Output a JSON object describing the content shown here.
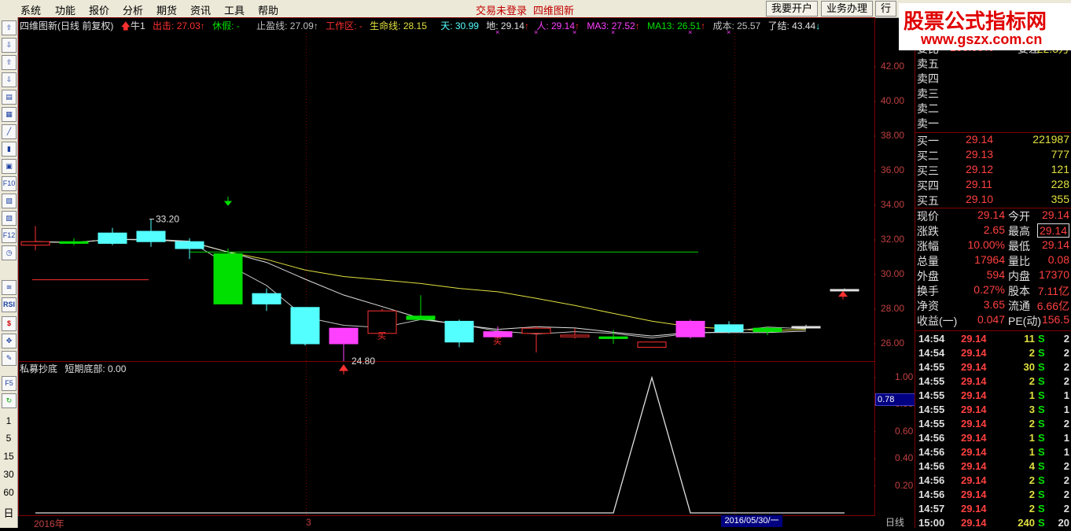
{
  "menu": {
    "items": [
      "系统",
      "功能",
      "报价",
      "分析",
      "期货",
      "资讯",
      "工具",
      "帮助"
    ],
    "status_login": "交易未登录",
    "status_view": "四维图新",
    "buttons": [
      "我要开户",
      "业务办理",
      "行"
    ]
  },
  "toolbar": {
    "icons": [
      "up-arrow-icon",
      "down-arrow-icon",
      "up-arrow-icon",
      "down-arrow-icon",
      "report-icon",
      "table-icon",
      "line-chart-icon",
      "candle-icon",
      "window-icon",
      "f10-icon",
      "news-icon",
      "doc-icon",
      "f12-icon",
      "clock-icon",
      "multi-chart-icon",
      "rsi-icon",
      "dollar-icon",
      "move-icon",
      "pencil-icon",
      "f5-icon",
      "refresh-icon"
    ],
    "icon_labels": {
      "f10": "F10",
      "f12": "F12",
      "rsi": "RSI",
      "f5": "F5",
      "dollar": "$"
    },
    "periods": [
      "1",
      "5",
      "15",
      "30",
      "60",
      "日"
    ]
  },
  "info": {
    "title": "四维图新(日线 前复权)",
    "niu": "牛1",
    "chuji": "出击: 27.03",
    "xiujia": "休假: -",
    "zhiying": "止盈线: 27.09",
    "gongzuoqu": "工作区: -",
    "shengming": "生命线: 28.15",
    "tian": "天: 30.99",
    "di": "地: 29.14",
    "ren": "人: 29.14",
    "ma3": "MA3: 27.52",
    "ma13": "MA13: 26.51",
    "chengben": "成本: 25.57",
    "liaojie": "了结: 43.44"
  },
  "indicator": {
    "name": "私募抄底",
    "value": "短期底部: 0.00",
    "current": "0.78"
  },
  "chart_data": {
    "type": "candlestick",
    "price_ticks": [
      "42.00",
      "40.00",
      "38.00",
      "36.00",
      "34.00",
      "32.00",
      "30.00",
      "28.00",
      "26.00"
    ],
    "price_range": [
      25.0,
      43.5
    ],
    "indicator_ticks": [
      "1.00",
      "0.80",
      "0.60",
      "0.40",
      "0.20"
    ],
    "indicator_range": [
      0,
      1
    ],
    "high_label": "33.20",
    "low_label": "24.80",
    "buy_marks": [
      "买",
      "买"
    ],
    "candles": [
      {
        "o": 31.7,
        "h": 32.8,
        "l": 31.4,
        "c": 31.9,
        "color": "red"
      },
      {
        "o": 31.9,
        "h": 32.1,
        "l": 31.7,
        "c": 31.8,
        "color": "green"
      },
      {
        "o": 31.8,
        "h": 32.7,
        "l": 31.7,
        "c": 32.4,
        "color": "cyan"
      },
      {
        "o": 32.5,
        "h": 33.2,
        "l": 31.6,
        "c": 31.9,
        "color": "cyan"
      },
      {
        "o": 31.9,
        "h": 32.1,
        "l": 30.9,
        "c": 31.5,
        "color": "cyan"
      },
      {
        "o": 31.2,
        "h": 31.5,
        "l": 28.3,
        "c": 28.3,
        "color": "green"
      },
      {
        "o": 28.9,
        "h": 29.2,
        "l": 27.9,
        "c": 28.3,
        "color": "cyan"
      },
      {
        "o": 28.1,
        "h": 28.1,
        "l": 25.9,
        "c": 26.0,
        "color": "cyan"
      },
      {
        "o": 26.0,
        "h": 26.9,
        "l": 25.0,
        "c": 26.9,
        "color": "magenta"
      },
      {
        "o": 26.6,
        "h": 28.0,
        "l": 26.5,
        "c": 27.9,
        "color": "red"
      },
      {
        "o": 27.6,
        "h": 28.8,
        "l": 27.5,
        "c": 27.4,
        "color": "green"
      },
      {
        "o": 27.3,
        "h": 27.4,
        "l": 25.8,
        "c": 26.1,
        "color": "cyan"
      },
      {
        "o": 26.4,
        "h": 27.0,
        "l": 26.3,
        "c": 26.7,
        "color": "magenta"
      },
      {
        "o": 26.6,
        "h": 27.0,
        "l": 25.5,
        "c": 26.9,
        "color": "red"
      },
      {
        "o": 26.4,
        "h": 26.9,
        "l": 26.3,
        "c": 26.5,
        "color": "red"
      },
      {
        "o": 26.3,
        "h": 26.8,
        "l": 26.0,
        "c": 26.4,
        "color": "green"
      },
      {
        "o": 25.8,
        "h": 26.1,
        "l": 25.8,
        "c": 26.1,
        "color": "red"
      },
      {
        "o": 26.4,
        "h": 27.4,
        "l": 26.3,
        "c": 27.3,
        "color": "magenta"
      },
      {
        "o": 27.1,
        "h": 27.3,
        "l": 26.6,
        "c": 26.7,
        "color": "cyan"
      },
      {
        "o": 26.7,
        "h": 27.0,
        "l": 26.5,
        "c": 26.9,
        "color": "green"
      },
      {
        "o": 27.0,
        "h": 27.1,
        "l": 26.9,
        "c": 27.0,
        "color": "white"
      },
      {
        "o": 29.1,
        "h": 29.2,
        "l": 29.1,
        "c": 29.14,
        "color": "white"
      }
    ],
    "indicator_series": [
      0,
      0,
      0,
      0,
      0,
      0,
      0,
      0,
      0,
      0,
      0,
      0,
      0,
      0,
      0,
      0,
      1,
      0,
      0,
      0,
      0,
      0
    ],
    "colors": {
      "up": "#ff3030",
      "down": "#54ffff",
      "green": "#00e000",
      "magenta": "#ff40ff",
      "grid": "#800000"
    },
    "x_labels": [
      "2016年",
      "3"
    ],
    "date_cursor": "2016/05/30/一",
    "period": "日线"
  },
  "order_book": {
    "top": [
      "委比",
      "100.00%",
      "委差",
      "22.3万"
    ],
    "sell": [
      {
        "label": "卖五",
        "price": "",
        "vol": ""
      },
      {
        "label": "卖四",
        "price": "",
        "vol": ""
      },
      {
        "label": "卖三",
        "price": "",
        "vol": ""
      },
      {
        "label": "卖二",
        "price": "",
        "vol": ""
      },
      {
        "label": "卖一",
        "price": "",
        "vol": ""
      }
    ],
    "buy": [
      {
        "label": "买一",
        "price": "29.14",
        "vol": "221987"
      },
      {
        "label": "买二",
        "price": "29.13",
        "vol": "777"
      },
      {
        "label": "买三",
        "price": "29.12",
        "vol": "121"
      },
      {
        "label": "买四",
        "price": "29.11",
        "vol": "228"
      },
      {
        "label": "买五",
        "price": "29.10",
        "vol": "355"
      }
    ]
  },
  "quote": [
    {
      "l1": "现价",
      "v1": "29.14",
      "l2": "今开",
      "v2": "29.14"
    },
    {
      "l1": "涨跌",
      "v1": "2.65",
      "l2": "最高",
      "v2": "29.14"
    },
    {
      "l1": "涨幅",
      "v1": "10.00%",
      "l2": "最低",
      "v2": "29.14"
    },
    {
      "l1": "总量",
      "v1": "17964",
      "l2": "量比",
      "v2": "0.08"
    },
    {
      "l1": "外盘",
      "v1": "594",
      "l2": "内盘",
      "v2": "17370"
    },
    {
      "l1": "换手",
      "v1": "0.27%",
      "l2": "股本",
      "v2": "7.11亿"
    },
    {
      "l1": "净资",
      "v1": "3.65",
      "l2": "流通",
      "v2": "6.66亿"
    },
    {
      "l1": "收益(一)",
      "v1": "0.047",
      "l2": "PE(动)",
      "v2": "156.5"
    }
  ],
  "ticks": [
    {
      "t": "14:54",
      "p": "29.14",
      "v": "11",
      "s": "S",
      "n": "2"
    },
    {
      "t": "14:54",
      "p": "29.14",
      "v": "2",
      "s": "S",
      "n": "2"
    },
    {
      "t": "14:55",
      "p": "29.14",
      "v": "30",
      "s": "S",
      "n": "2"
    },
    {
      "t": "14:55",
      "p": "29.14",
      "v": "2",
      "s": "S",
      "n": "2"
    },
    {
      "t": "14:55",
      "p": "29.14",
      "v": "1",
      "s": "S",
      "n": "1"
    },
    {
      "t": "14:55",
      "p": "29.14",
      "v": "3",
      "s": "S",
      "n": "1"
    },
    {
      "t": "14:55",
      "p": "29.14",
      "v": "2",
      "s": "S",
      "n": "2"
    },
    {
      "t": "14:56",
      "p": "29.14",
      "v": "1",
      "s": "S",
      "n": "1"
    },
    {
      "t": "14:56",
      "p": "29.14",
      "v": "1",
      "s": "S",
      "n": "1"
    },
    {
      "t": "14:56",
      "p": "29.14",
      "v": "4",
      "s": "S",
      "n": "2"
    },
    {
      "t": "14:56",
      "p": "29.14",
      "v": "2",
      "s": "S",
      "n": "2"
    },
    {
      "t": "14:56",
      "p": "29.14",
      "v": "2",
      "s": "S",
      "n": "2"
    },
    {
      "t": "14:57",
      "p": "29.14",
      "v": "2",
      "s": "S",
      "n": "2"
    },
    {
      "t": "15:00",
      "p": "29.14",
      "v": "240",
      "s": "S",
      "n": "20"
    }
  ],
  "watermark": {
    "line1": "股票公式指标网",
    "line2": "www.gszx.com.cn"
  }
}
